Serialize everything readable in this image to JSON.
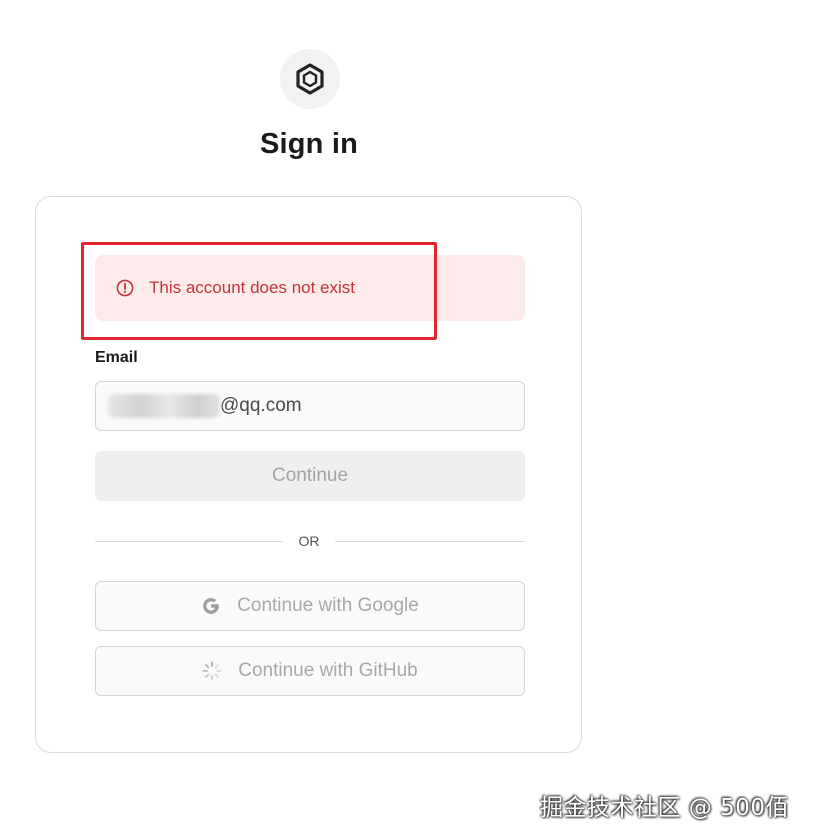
{
  "logo": {
    "icon": "hexagon-logo-icon"
  },
  "title": "Sign in",
  "alert": {
    "icon": "alert-circle-icon",
    "message": "This account does not exist",
    "color": "#c4343b",
    "background": "#fdeaea"
  },
  "highlight": {
    "color": "#e0262e"
  },
  "email": {
    "label": "Email",
    "value_visible": "@qq.com"
  },
  "continue_button": {
    "label": "Continue"
  },
  "divider": {
    "label": "OR"
  },
  "oauth": {
    "google": {
      "label": "Continue with Google",
      "icon": "google-icon"
    },
    "github": {
      "label": "Continue with GitHub",
      "icon": "loading-spinner-icon"
    }
  },
  "watermark": {
    "text": "掘金技术社区 @ 500佰"
  }
}
